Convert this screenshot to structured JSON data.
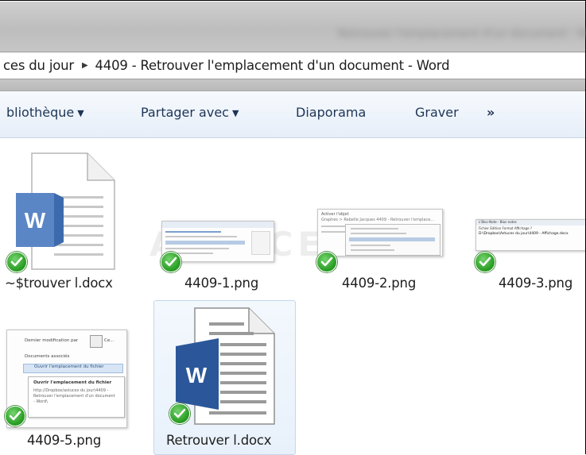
{
  "window": {
    "title": "Retrouver l'emplacement d'un document - Word"
  },
  "address_bar": {
    "crumbs": [
      "ces du jour",
      "4409 - Retrouver l'emplacement d'un document - Word"
    ],
    "separator_icon": "breadcrumb-arrow-icon"
  },
  "toolbar": {
    "items": [
      {
        "label": "bliothèque",
        "has_dropdown": true
      },
      {
        "label": "Partager avec",
        "has_dropdown": true
      },
      {
        "label": "Diaporama",
        "has_dropdown": false
      },
      {
        "label": "Graver",
        "has_dropdown": false
      },
      {
        "label": "»",
        "has_dropdown": false
      }
    ]
  },
  "files": [
    {
      "name": "~$trouver l.docx",
      "type": "word-document",
      "synced": true
    },
    {
      "name": "4409-1.png",
      "type": "image",
      "synced": true
    },
    {
      "name": "4409-2.png",
      "type": "image",
      "synced": true
    },
    {
      "name": "4409-3.png",
      "type": "image",
      "synced": true
    },
    {
      "name": "4409-5.png",
      "type": "image",
      "synced": true
    },
    {
      "name": "Retrouver l.docx",
      "type": "word-document",
      "synced": true,
      "selected": true
    }
  ],
  "thumbnail_text": {
    "t2_line1": "Activer l'objet",
    "t2_line2": "Graphes > Rebelle Jacques 4409 - Retrouver l'emplace...",
    "t3_line1": "L'Bloc-Note - Bloc-notes",
    "t3_menu": "Fichier  Edition  Format  Affichage  ?",
    "t3_path": "D:\\Dropbox\\Astuces du jour\\4409 - Affichage.docx",
    "t5_heading1": "Dernier modification par",
    "t5_user": "Ce...",
    "t5_heading2": "Documents associés",
    "t5_link": "Ouvrir l'emplacement du fichier",
    "t5_tip_title": "Ouvrir l'emplacement du fichier",
    "t5_tip_body": "http://Dropbox/astuces du jour\\4409 - Retrouver l'emplacement d'un document - Word\\"
  },
  "colors": {
    "word_blue": "#2b579a",
    "check_green": "#259a1f",
    "toolbar_text": "#1d3557",
    "selection_bg": "#e8f1fb"
  },
  "icons": {
    "sync_status": "check-circle-icon",
    "word_doc": "word-document-icon"
  }
}
